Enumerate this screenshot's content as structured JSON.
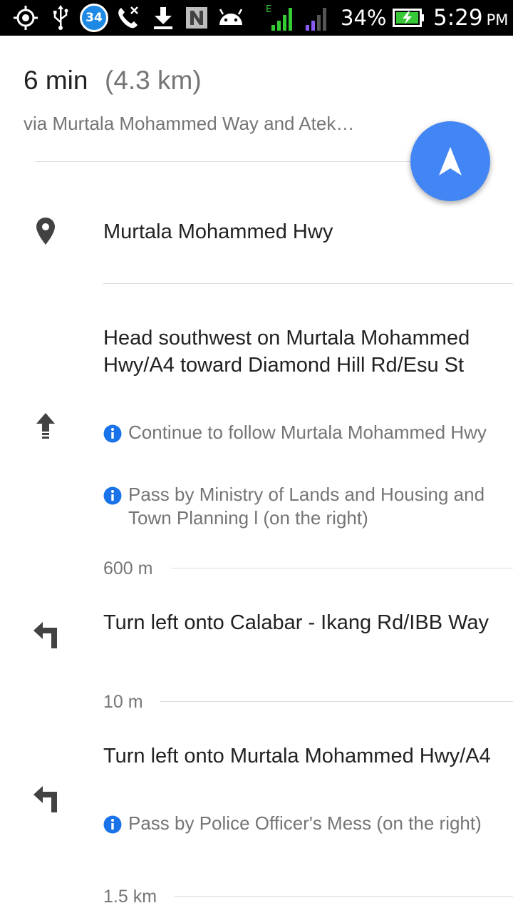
{
  "status_bar": {
    "notification_count": "34",
    "network_type": "E",
    "battery_percent": "34%",
    "time": "5:29",
    "time_suffix": "PM",
    "icons": [
      "location-icon",
      "usb-icon",
      "notification-count-badge",
      "missed-call-icon",
      "download-icon",
      "n-app-icon",
      "android-icon",
      "signal-icon",
      "signal-icon-2",
      "battery-charging-icon"
    ],
    "colors": {
      "signal_green": "#33cc33",
      "signal_purple": "#8a5cf5",
      "battery_green": "#37c837",
      "badge_blue": "#1e88e5"
    }
  },
  "summary": {
    "duration": "6 min",
    "distance": "(4.3 km)",
    "via": "via Murtala Mohammed Way and Atek…",
    "navigate_button": "navigation-arrow-icon",
    "accent_color": "#4285f4"
  },
  "start": {
    "label": "Murtala Mohammed Hwy",
    "icon": "place-pin-icon"
  },
  "steps": [
    {
      "icon": "straight-arrow-icon",
      "instruction": "Head southwest on Murtala Mohammed Hwy/A4 toward Diamond Hill Rd/Esu St",
      "notes": [
        "Continue to follow Murtala Mohammed Hwy",
        "Pass by Ministry of Lands and Housing and Town Planning l (on the right)"
      ],
      "distance": "600 m"
    },
    {
      "icon": "turn-left-icon",
      "instruction": "Turn left onto Calabar - Ikang Rd/IBB Way",
      "notes": [],
      "distance": "10 m"
    },
    {
      "icon": "turn-left-icon",
      "instruction": "Turn left onto Murtala Mohammed Hwy/A4",
      "notes": [
        "Pass by Police Officer's Mess (on the right)"
      ],
      "distance": "1.5 km"
    }
  ],
  "info_icon": "info-icon",
  "info_color": "#1a73e8"
}
